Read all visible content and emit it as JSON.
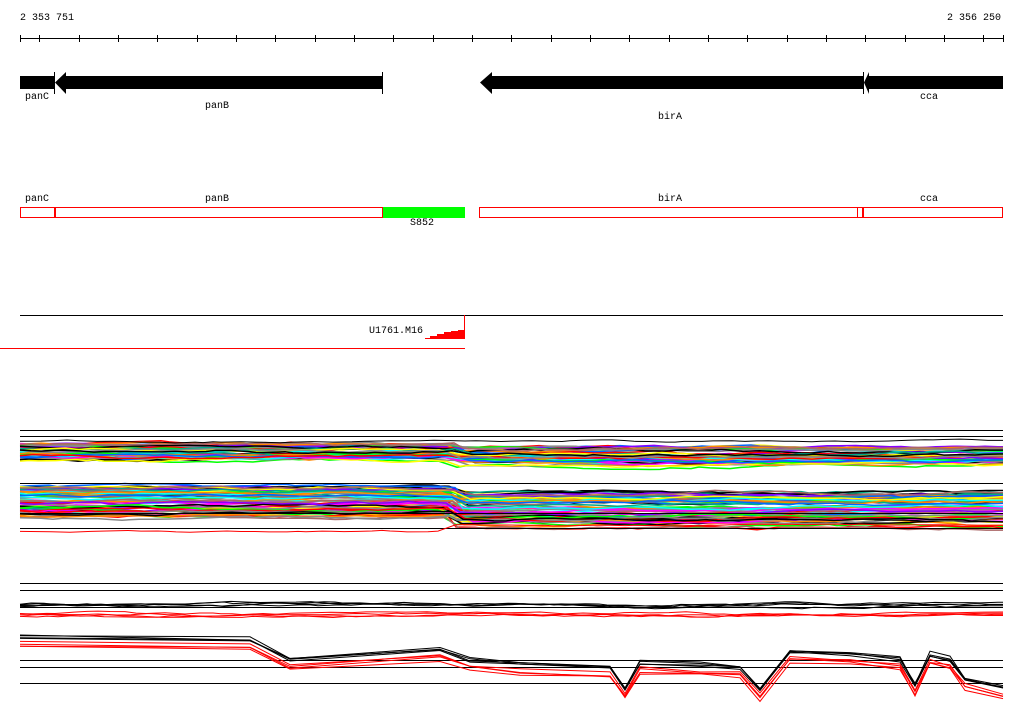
{
  "ruler": {
    "start_label": "2 353 751",
    "end_label": "2 356 250",
    "start": 2353751,
    "end": 2356250,
    "tick_step": 100
  },
  "genes_track": [
    {
      "name": "panC",
      "start": 2353751,
      "end": 2353838,
      "strand": "-"
    },
    {
      "name": "panB",
      "start": 2353838,
      "end": 2354673,
      "strand": "-"
    },
    {
      "name": "birA",
      "start": 2354924,
      "end": 2355899,
      "strand": "-"
    },
    {
      "name": "cca",
      "start": 2355899,
      "end": 2356250,
      "strand": "-"
    }
  ],
  "annotation_track": {
    "features": [
      {
        "name": "panC"
      },
      {
        "name": "panB"
      },
      {
        "name": "S852"
      },
      {
        "name": "birA"
      },
      {
        "name": "cca"
      }
    ]
  },
  "segment_track": {
    "label": "U1761.M16"
  },
  "colors": {
    "feature_outline": "#ff0000",
    "highlight": "#00ff00",
    "gene": "#000000"
  }
}
